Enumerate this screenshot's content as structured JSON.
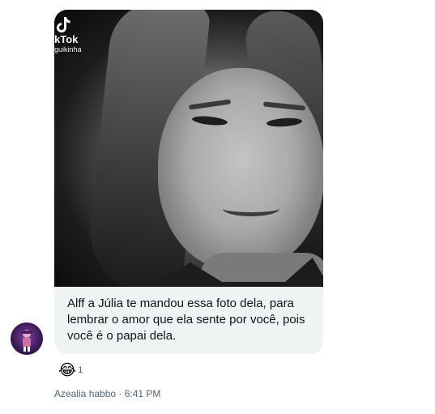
{
  "message": {
    "image_watermark": {
      "brand": "kTok",
      "username": "guikinha"
    },
    "text": "Alff a Júlia te mandou essa foto dela, para lembrar o amor que ela sente por você, pois você é o papai dela."
  },
  "reaction": {
    "emoji": "😂",
    "count": "1"
  },
  "meta": {
    "sender": "Azealia habbo",
    "separator": " · ",
    "time": "6:41 PM"
  }
}
